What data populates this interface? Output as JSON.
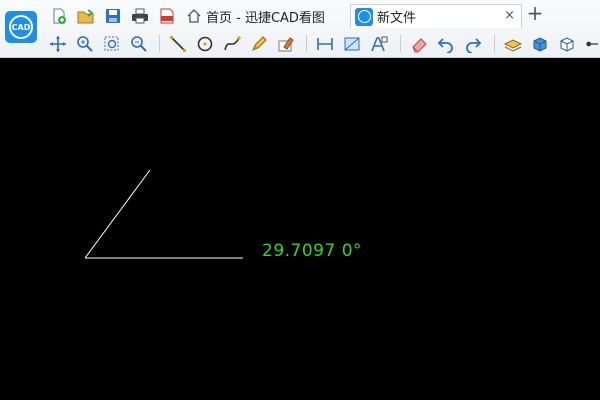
{
  "app": {
    "logo_text": "CAD"
  },
  "file_toolbar": [
    {
      "name": "new-file-icon"
    },
    {
      "name": "open-file-icon"
    },
    {
      "name": "save-icon"
    },
    {
      "name": "print-icon"
    },
    {
      "name": "export-pdf-icon"
    }
  ],
  "tabs": [
    {
      "label": "首页 - 迅捷CAD看图",
      "icon": "home-icon",
      "active": false
    },
    {
      "label": "新文件",
      "icon": "cad-file-icon",
      "active": true,
      "close_symbol": "×"
    }
  ],
  "tab_add_symbol": "+",
  "tool_ribbon": [
    {
      "name": "pan-icon"
    },
    {
      "name": "zoom-in-icon"
    },
    {
      "name": "zoom-window-icon"
    },
    {
      "name": "zoom-out-icon"
    },
    {
      "name": "line-tool-icon"
    },
    {
      "name": "circle-tool-icon"
    },
    {
      "name": "polyline-tool-icon"
    },
    {
      "name": "pencil-tool-icon"
    },
    {
      "name": "annotate-tool-icon"
    },
    {
      "name": "measure-distance-icon"
    },
    {
      "name": "measure-area-icon"
    },
    {
      "name": "text-tool-icon"
    },
    {
      "name": "eraser-icon"
    },
    {
      "name": "undo-icon"
    },
    {
      "name": "redo-icon"
    },
    {
      "name": "layers-icon"
    },
    {
      "name": "3d-view-icon"
    },
    {
      "name": "3d-box-icon"
    },
    {
      "name": "more-tools-icon"
    }
  ],
  "drawing": {
    "background_color": "#000000",
    "line_color": "#ffffff",
    "dimension_color": "#2bd82b",
    "dimension_text": "29.7097 0°"
  }
}
